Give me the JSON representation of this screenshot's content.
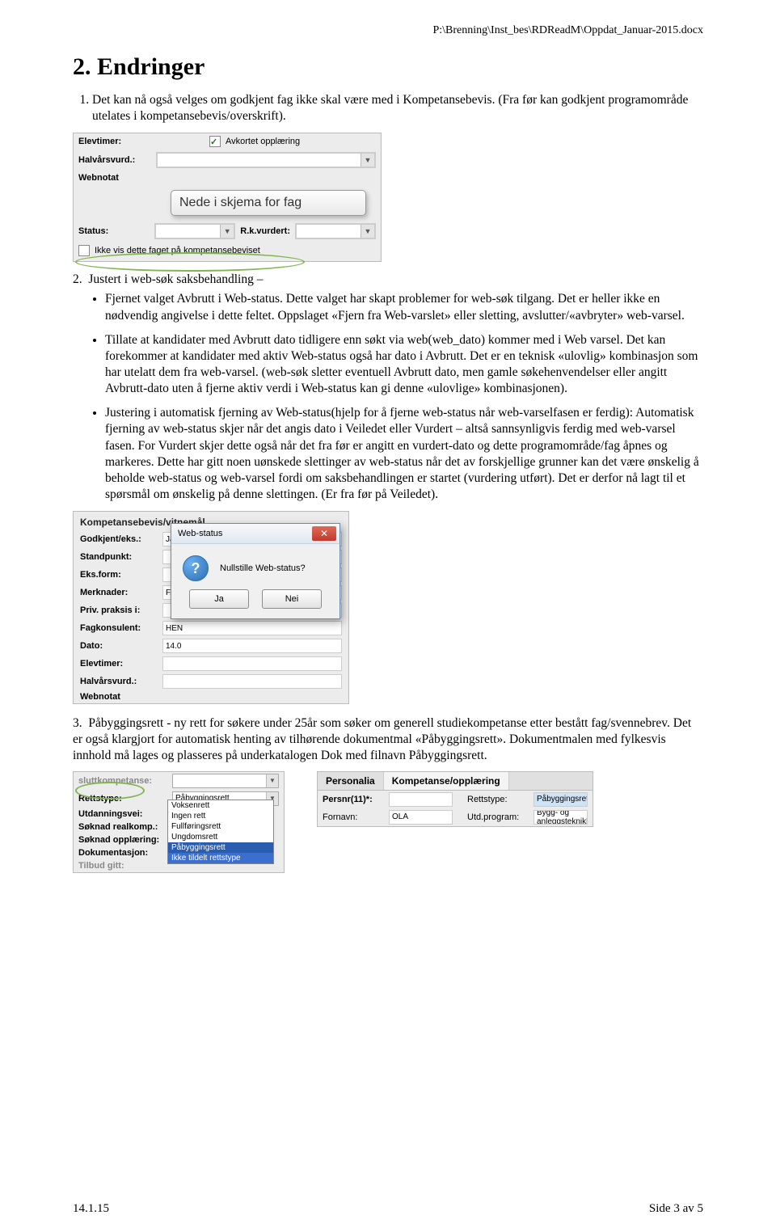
{
  "header_path": "P:\\Brenning\\Inst_bes\\RDReadM\\Oppdat_Januar-2015.docx",
  "heading": "2. Endringer",
  "item1": "Det kan nå også velges om godkjent fag ikke skal være med i Kompetansebevis. (Fra før kan godkjent programområde utelates i kompetansebevis/overskrift).",
  "item2_intro": "Justert i web-søk saksbehandling –",
  "item2_b1": "Fjernet valget Avbrutt i Web-status. Dette valget har skapt problemer for web-søk tilgang. Det er heller ikke en nødvendig angivelse i dette feltet. Oppslaget «Fjern fra Web-varslet» eller sletting, avslutter/«avbryter» web-varsel.",
  "item2_b2": "Tillate at kandidater med Avbrutt dato tidligere enn søkt via web(web_dato) kommer med i Web varsel. Det kan forekommer at kandidater med aktiv Web-status også har dato i Avbrutt. Det er en teknisk «ulovlig» kombinasjon som har utelatt dem fra web-varsel. (web-søk sletter eventuell Avbrutt dato, men gamle søkehenvendelser eller angitt Avbrutt-dato uten å fjerne aktiv verdi i Web-status kan gi denne «ulovlige» kombinasjonen).",
  "item2_b3": "Justering i automatisk fjerning av Web-status(hjelp for å fjerne web-status når web-varselfasen er ferdig): Automatisk fjerning av web-status skjer når det angis dato i Veiledet eller Vurdert – altså sannsynligvis ferdig med web-varsel fasen. For Vurdert skjer dette også når det fra før er angitt en vurdert-dato og dette programområde/fag åpnes og markeres. Dette har gitt noen uønskede slettinger av web-status når det av forskjellige grunner kan det være ønskelig å beholde web-status og web-varsel fordi om saksbehandlingen er startet (vurdering utført). Det er derfor nå lagt til et spørsmål om ønskelig på denne slettingen. (Er fra før på Veiledet).",
  "item3": "Påbyggingsrett - ny rett for søkere under 25år som søker om generell studiekompetanse etter bestått fag/svennebrev. Det er også klargjort for automatisk henting av tilhørende dokumentmal «Påbyggingsrett». Dokumentmalen med fylkesvis innhold må lages og plasseres på underkatalogen Dok med filnavn Påbyggingsrett.",
  "fig1": {
    "elevtimer": "Elevtimer:",
    "avkortet": "Avkortet opplæring",
    "halvars": "Halvårsvurd.:",
    "webnotat": "Webnotat",
    "popup": "Nede i skjema for fag",
    "status": "Status:",
    "rkvurdert": "R.k.vurdert:",
    "ikkevis": "Ikke vis dette faget på kompetansebeviset"
  },
  "fig2": {
    "section": "Kompetansebevis/vitnemål",
    "rows": {
      "godkjent": "Godkjent/eks.:",
      "godkjent_v": "Ja",
      "standpunkt": "Standpunkt:",
      "eksform": "Eks.form:",
      "merknader": "Merknader:",
      "merknader_v": "FAM",
      "privpraksis": "Priv. praksis i:",
      "fagkonsulent": "Fagkonsulent:",
      "fagkonsulent_v": "HEN",
      "dato": "Dato:",
      "dato_v": "14.0",
      "elevtimer": "Elevtimer:",
      "halvars": "Halvårsvurd.:",
      "webnotat": "Webnotat"
    },
    "dialog": {
      "title": "Web-status",
      "msg": "Nullstille Web-status?",
      "yes": "Ja",
      "no": "Nei"
    }
  },
  "fig3": {
    "panelA": {
      "sluttkompetanse": "sluttkompetanse:",
      "rettstype": "Rettstype:",
      "rettstype_val": "Påbyggingsrett",
      "utdanningsvei": "Utdanningsvei:",
      "soknad_realkomp": "Søknad realkomp.:",
      "soknad_opplaering": "Søknad opplæring:",
      "dokumentasjon": "Dokumentasjon:",
      "tilbud_gitt": "Tilbud gitt:",
      "dd_options": [
        "Voksenrett",
        "Ingen rett",
        "Fullføringsrett",
        "Ungdomsrett",
        "Påbyggingsrett",
        "Ikke tildelt rettstype"
      ],
      "dd_selected": 4
    },
    "panelB": {
      "tab1": "Personalia",
      "tab2": "Kompetanse/opplæring",
      "persnr_l": "Persnr(11)*:",
      "persnr_v": "",
      "rettstype_l": "Rettstype:",
      "rettstype_v": "Påbyggingsrett",
      "fornavn_l": "Fornavn:",
      "fornavn_v": "OLA",
      "utd_l": "Utd.program:",
      "utd_v": "Bygg- og anleggsteknikk"
    }
  },
  "footer": {
    "left": "14.1.15",
    "right": "Side 3 av 5"
  }
}
